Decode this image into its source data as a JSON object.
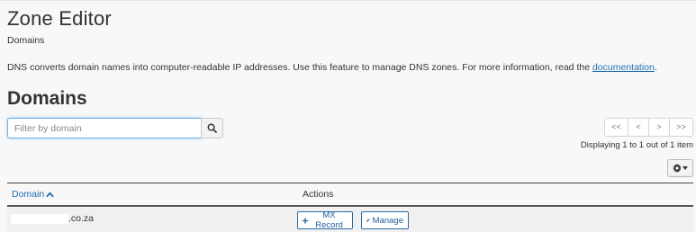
{
  "header": {
    "title": "Zone Editor",
    "breadcrumb": "Domains"
  },
  "intro": {
    "text": "DNS converts domain names into computer-readable IP addresses. Use this feature to manage DNS zones. For more information, read the",
    "link_label": "documentation",
    "suffix": "."
  },
  "domains": {
    "title": "Domains",
    "search": {
      "placeholder": "Filter by domain",
      "value": "",
      "button_icon": "search-icon"
    },
    "pagination": {
      "first": "<<",
      "prev": "<",
      "next": ">",
      "last": ">>",
      "info": "Displaying 1 to 1 out of 1 item"
    },
    "settings_icon": "gear-icon",
    "table": {
      "columns": {
        "domain": "Domain",
        "actions": "Actions"
      },
      "sort": {
        "column": "domain",
        "direction": "ascending"
      },
      "rows": [
        {
          "domain_suffix": ".co.za",
          "domain_redacted": true,
          "actions": {
            "mx_label": "MX Record",
            "mx_icon": "plus-icon",
            "manage_label": "Manage",
            "manage_icon": "wrench-icon"
          }
        }
      ]
    }
  },
  "colors": {
    "link": "#1f6fb2",
    "focus_border": "#66afe9",
    "button_border": "#2d6ca2",
    "background": "#f8f8f8",
    "row_background": "#f0f0f0"
  }
}
